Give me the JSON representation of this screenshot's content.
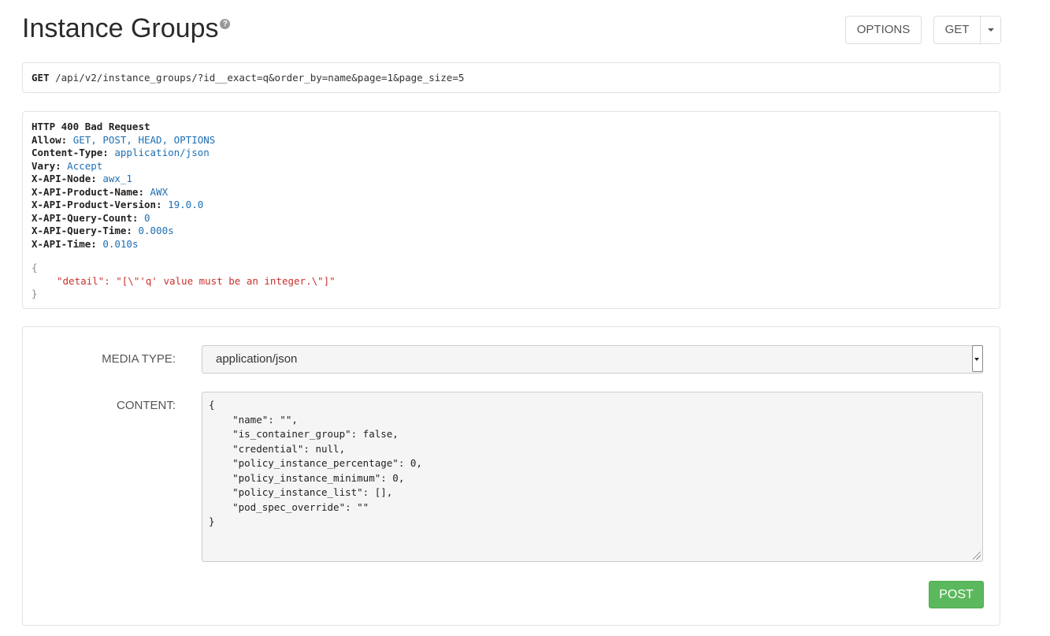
{
  "header": {
    "title": "Instance Groups",
    "help_icon": "?",
    "options_label": "OPTIONS",
    "get_label": "GET"
  },
  "request": {
    "method": "GET",
    "path": "/api/v2/instance_groups/?id__exact=q&order_by=name&page=1&page_size=5"
  },
  "response": {
    "status_line": "HTTP 400 Bad Request",
    "headers": [
      {
        "key": "Allow:",
        "value": "GET, POST, HEAD, OPTIONS"
      },
      {
        "key": "Content-Type:",
        "value": "application/json"
      },
      {
        "key": "Vary:",
        "value": "Accept"
      },
      {
        "key": "X-API-Node:",
        "value": "awx_1"
      },
      {
        "key": "X-API-Product-Name:",
        "value": "AWX"
      },
      {
        "key": "X-API-Product-Version:",
        "value": "19.0.0"
      },
      {
        "key": "X-API-Query-Count:",
        "value": "0"
      },
      {
        "key": "X-API-Query-Time:",
        "value": "0.000s"
      },
      {
        "key": "X-API-Time:",
        "value": "0.010s"
      }
    ],
    "body_open": "{",
    "body_detail": "\"detail\": \"[\\\"'q' value must be an integer.\\\"]\"",
    "body_close": "}"
  },
  "form": {
    "media_type_label": "MEDIA TYPE:",
    "media_type_value": "application/json",
    "content_label": "CONTENT:",
    "content_value": "{\n    \"name\": \"\",\n    \"is_container_group\": false,\n    \"credential\": null,\n    \"policy_instance_percentage\": 0,\n    \"policy_instance_minimum\": 0,\n    \"policy_instance_list\": [],\n    \"pod_spec_override\": \"\"\n}",
    "post_label": "POST"
  },
  "colors": {
    "header_value": "#1f6fb2",
    "error_text": "#c9302c",
    "post_button": "#5cb85c"
  }
}
